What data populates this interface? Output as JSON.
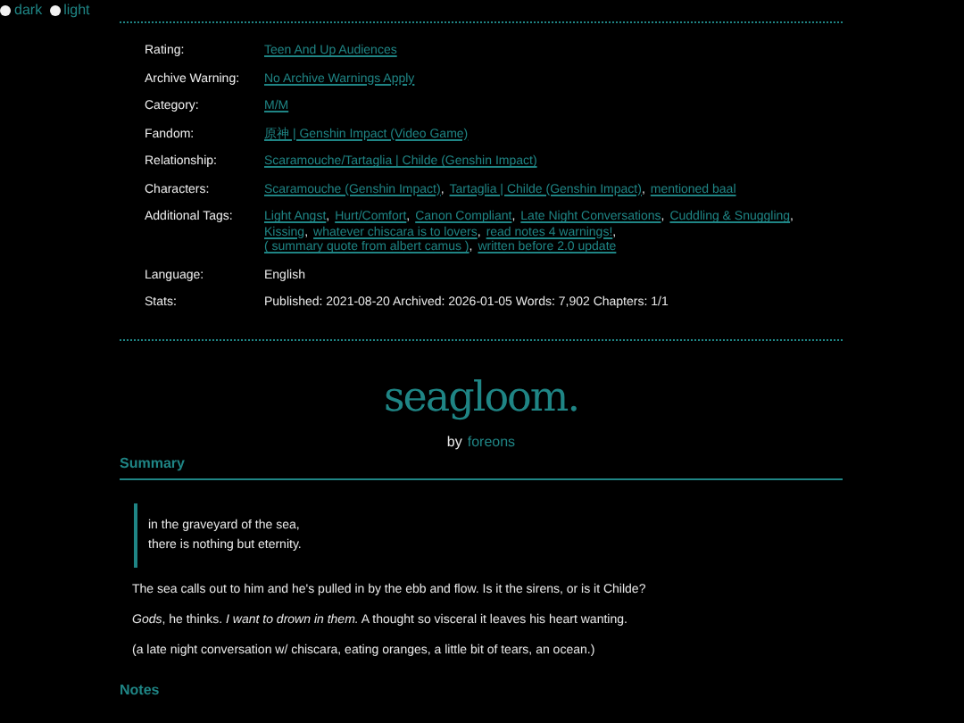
{
  "theme_switch": [
    {
      "label": "dark",
      "selected": false
    },
    {
      "label": "light",
      "selected": false
    }
  ],
  "meta": [
    {
      "label": "Rating:",
      "kind": "links",
      "values": [
        {
          "text": "Teen And Up Audiences"
        }
      ]
    },
    {
      "label": "Archive Warning:",
      "kind": "links",
      "values": [
        {
          "text": "No Archive Warnings Apply"
        }
      ]
    },
    {
      "label": "Category:",
      "kind": "links",
      "values": [
        {
          "text": "M/M"
        }
      ]
    },
    {
      "label": "Fandom:",
      "kind": "links",
      "values": [
        {
          "text": "原神 | Genshin Impact (Video Game)"
        }
      ]
    },
    {
      "label": "Relationship:",
      "kind": "links",
      "values": [
        {
          "text": "Scaramouche/Tartaglia | Childe (Genshin Impact)"
        }
      ]
    },
    {
      "label": "Characters:",
      "kind": "links",
      "values": [
        {
          "text": "Scaramouche (Genshin Impact)",
          "after": ","
        },
        {
          "text": "Tartaglia | Childe (Genshin Impact)",
          "after": ","
        },
        {
          "text": "mentioned baal"
        }
      ]
    },
    {
      "label": "Additional Tags:",
      "kind": "links",
      "values": [
        {
          "text": "Light Angst",
          "after": ","
        },
        {
          "text": "Hurt/Comfort",
          "after": ","
        },
        {
          "text": "Canon Compliant",
          "after": ","
        },
        {
          "text": "Late Night Conversations",
          "after": ","
        },
        {
          "text": "Cuddling & Snuggling",
          "after": ","
        },
        {
          "text": "Kissing",
          "after": ","
        },
        {
          "text": "whatever chiscara is to lovers",
          "after": ","
        },
        {
          "text": "read notes 4 warnings!",
          "after": ","
        },
        {
          "text": "( summary quote from albert camus )",
          "after": ","
        },
        {
          "text": "written before 2.0 update"
        }
      ]
    },
    {
      "label": "Language:",
      "kind": "text",
      "text": "English"
    },
    {
      "label": "Stats:",
      "kind": "text",
      "text": "Published: 2021-08-20 Archived: 2026-01-05 Words: 7,902 Chapters: 1/1"
    }
  ],
  "title": "seagloom.",
  "byline": {
    "prefix": "by",
    "author": "foreons"
  },
  "summary": {
    "heading": "Summary",
    "quote": [
      "in the graveyard of the sea,",
      "there is nothing but eternity."
    ],
    "paragraphs": [
      "The sea calls out to him and he's pulled in by the ebb and flow. Is it the sirens, or is it Childe?",
      "*Gods*, he thinks. *I want to drown in them.* A thought so visceral it leaves his heart wanting.",
      "(a late night conversation w/ chiscara, eating oranges, a little bit of tears, an ocean.)"
    ]
  },
  "notes": {
    "heading": "Notes"
  }
}
